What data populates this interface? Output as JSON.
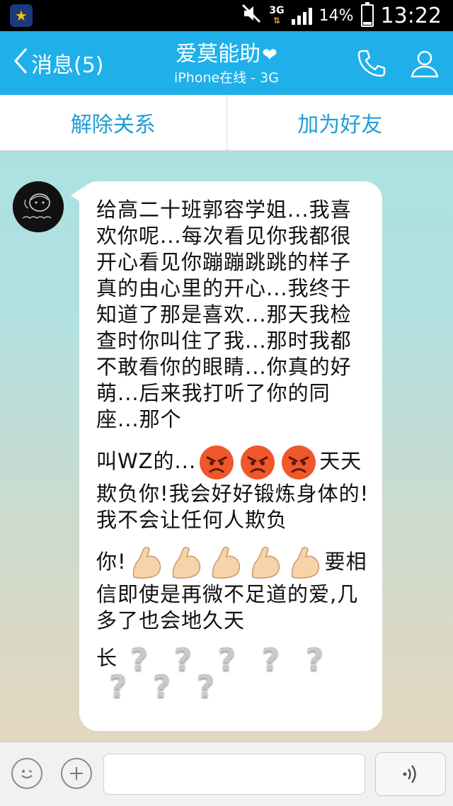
{
  "status_bar": {
    "network": "3G",
    "battery": "14%",
    "battery_level": 0.14,
    "time": "13:22"
  },
  "header": {
    "back_label": "消息(5)",
    "title": "爱莫能助",
    "subtitle": "iPhone在线 - 3G"
  },
  "actions": {
    "remove_label": "解除关系",
    "add_friend_label": "加为好友"
  },
  "message": {
    "p1": "给高二十班郭容学姐...我喜欢你呢...每次看见你我都很开心看见你蹦蹦跳跳的样子真的由心里的开心...我终于知道了那是喜欢...那天我检查时你叫住了我...那时我都不敢看你的眼睛...你真的好萌...后来我打听了你的同座...那个",
    "p2_start": "叫WZ的...",
    "p2_end": "天天欺负你!我会好好锻炼身体的!我不会让任何人欺负",
    "p3_start": "你!",
    "p3_end": "要相信即使是再微不足道的爱,几多了也会地久天",
    "p4_start": "长"
  },
  "input": {
    "placeholder": ""
  }
}
